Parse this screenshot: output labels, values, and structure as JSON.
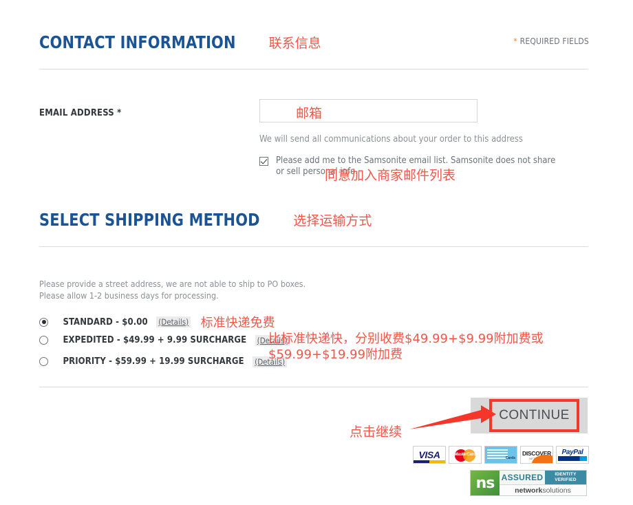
{
  "contact": {
    "heading": "CONTACT INFORMATION",
    "heading_annotation": "联系信息",
    "required_star": "*",
    "required_text": " REQUIRED FIELDS",
    "email_label": "EMAIL ADDRESS *",
    "email_value": "",
    "email_placeholder": "",
    "email_annotation": "邮箱",
    "helper_text": "We will send all communications about your order to this address",
    "optin_text": "Please add me to the Samsonite email list. Samsonite does not share or sell personal info.",
    "optin_checked": true,
    "optin_annotation": "同意加入商家邮件列表"
  },
  "shipping": {
    "heading": "SELECT SHIPPING METHOD",
    "heading_annotation": "选择运输方式",
    "note_line1": "Please provide a street address, we are not able to ship to PO boxes.",
    "note_line2": "Please allow 1-2 business days for processing.",
    "details_label": "(Details)",
    "options": [
      {
        "label": "STANDARD - $0.00",
        "details": "(Details)",
        "selected": true,
        "annotation": "标准快递免费"
      },
      {
        "label": "EXPEDITED - $49.99 + 9.99 SURCHARGE",
        "details": "(Details)",
        "selected": false,
        "annotation": ""
      },
      {
        "label": "PRIORITY - $59.99 + 19.99 SURCHARGE",
        "details": "(Details)",
        "selected": false,
        "annotation": ""
      }
    ],
    "price_annotation": "比标准快递快，分别收费$49.99+$9.99附加费或$59.99+$19.99附加费"
  },
  "actions": {
    "continue_label": "CONTINUE",
    "continue_annotation": "点击继续"
  },
  "payment_badges": [
    {
      "name": "visa",
      "label": "VISA"
    },
    {
      "name": "mastercard",
      "label": "MasterCard"
    },
    {
      "name": "american-express",
      "label": "Cards"
    },
    {
      "name": "discover",
      "label": "DISCOVER",
      "sublabel": "NETWORK"
    },
    {
      "name": "paypal",
      "label": "PayPal"
    }
  ],
  "trust_seal": {
    "logo_text": "ns",
    "assured": "ASSURED",
    "verified_line1": "IDENTITY",
    "verified_line2": "VERIFIED",
    "brand_bold": "network",
    "brand_light": "solutions"
  },
  "colors": {
    "heading_blue": "#1b5494",
    "annotation_red": "#f4564a",
    "highlight_red": "#f4362b",
    "required_star": "#e8873a"
  }
}
